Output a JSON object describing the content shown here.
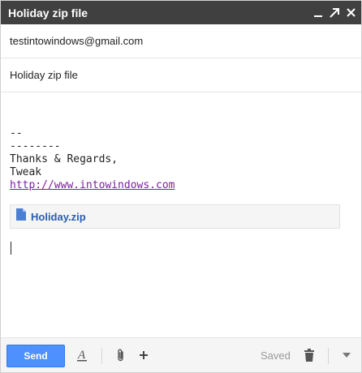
{
  "window": {
    "title": "Holiday zip file",
    "controls": {
      "minimize_icon": "minimize-icon",
      "popout_icon": "popout-arrow-icon",
      "close_icon": "close-icon"
    }
  },
  "compose": {
    "to": "testintowindows@gmail.com",
    "subject": "Holiday zip file",
    "body_lines": [
      "--",
      "--------",
      "Thanks & Regards,",
      "Tweak"
    ],
    "link": "http://www.intowindows.com",
    "attachment": {
      "name": "Holiday.zip",
      "icon": "file-icon"
    }
  },
  "toolbar": {
    "send_label": "Send",
    "saved_label": "Saved",
    "icons": [
      "formatting-icon",
      "paperclip-icon",
      "plus-icon",
      "trash-icon",
      "chevron-down-icon"
    ]
  },
  "colors": {
    "titlebar": "#404040",
    "send": "#4d90fe",
    "link": "#7b1fa2",
    "attachment_text": "#2a5db0"
  }
}
